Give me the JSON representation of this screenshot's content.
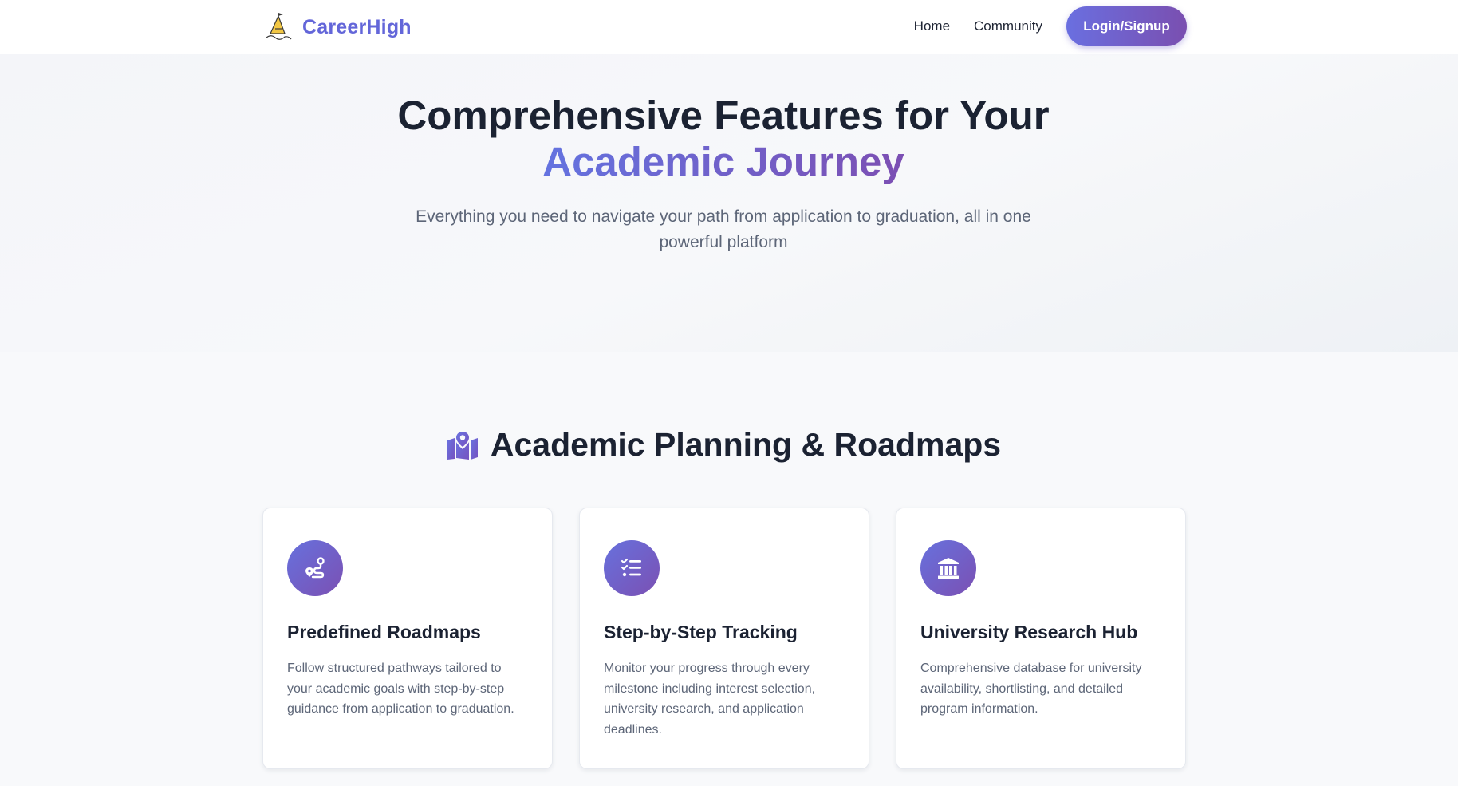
{
  "app": {
    "brand": "CareerHigh",
    "brand_color": "#6366d9"
  },
  "nav": {
    "items": [
      {
        "label": "Home"
      },
      {
        "label": "Community"
      }
    ],
    "login_label": "Login/Signup",
    "accent_gradient": [
      "#6a6fe0",
      "#7a4fb0"
    ]
  },
  "hero": {
    "title_line1": "Comprehensive Features for Your",
    "title_line2": "Academic Journey",
    "subtitle": "Everything you need to navigate your path from application to graduation, all in one powerful platform"
  },
  "section": {
    "icon": "map-location-icon",
    "title": "Academic Planning & Roadmaps",
    "cards": [
      {
        "icon": "route-icon",
        "title": "Predefined Roadmaps",
        "description": "Follow structured pathways tailored to your academic goals with step-by-step guidance from application to graduation."
      },
      {
        "icon": "checklist-icon",
        "title": "Step-by-Step Tracking",
        "description": "Monitor your progress through every milestone including interest selection, university research, and application deadlines."
      },
      {
        "icon": "university-icon",
        "title": "University Research Hub",
        "description": "Comprehensive database for university availability, shortlisting, and detailed program information."
      }
    ]
  }
}
